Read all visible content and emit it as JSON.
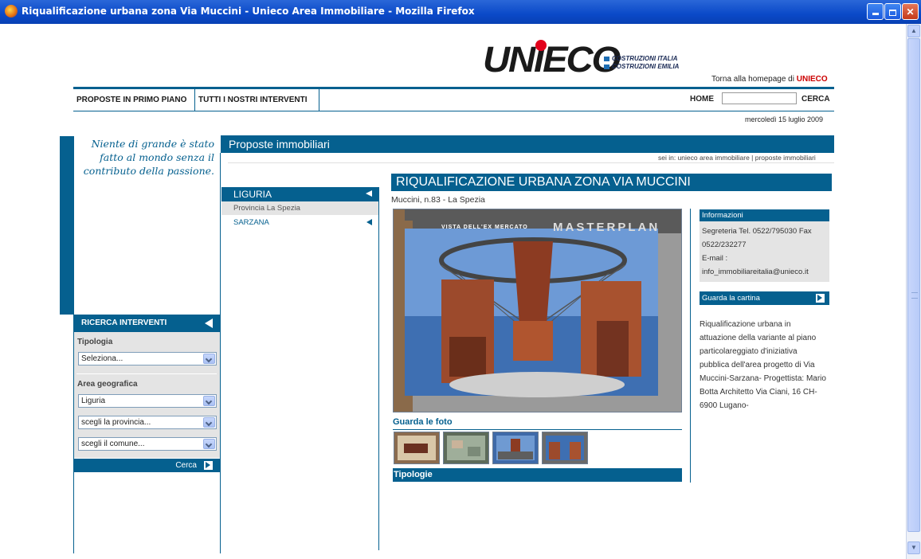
{
  "window": {
    "title": "Riqualificazione urbana zona Via Muccini - Unieco Area Immobiliare - Mozilla Firefox"
  },
  "header": {
    "logo_text": "UNIECO",
    "logo_sub1": "COSTRUZIONI ITALIA",
    "logo_sub2": "COSTRUZIONI EMILIA",
    "torna_prefix": "Torna alla homepage di",
    "torna_brand": "UNIECO",
    "nav": [
      "PROPOSTE IN PRIMO PIANO",
      "TUTTI I NOSTRI INTERVENTI"
    ],
    "home_label": "HOME",
    "search_value": "",
    "search_button": "CERCA",
    "date": "mercoledì 15 luglio 2009"
  },
  "sidebar": {
    "quote": "Niente di grande è stato fatto al mondo senza il contributo della passione.",
    "ricerca_title": "RICERCA INTERVENTI",
    "tipologia_label": "Tipologia",
    "tipologia_value": "Seleziona...",
    "area_label": "Area geografica",
    "area_value": "Liguria",
    "provincia_value": "scegli la provincia...",
    "comune_value": "scegli il comune...",
    "cerca_label": "Cerca"
  },
  "section": {
    "title": "Proposte immobiliari",
    "breadcrumb": "sei in: unieco area immobiliare | proposte immobiliari"
  },
  "region_menu": {
    "region": "LIGURIA",
    "province": "Provincia La Spezia",
    "town": "SARZANA"
  },
  "detail": {
    "title": "RIQUALIFICAZIONE URBANA ZONA VIA MUCCINI",
    "address": "Muccini, n.83 - La Spezia",
    "photo_caption_left": "VISTA DELL'EX MERCATO",
    "photo_caption_right": "MASTERPLAN",
    "gallery_label": "Guarda le foto",
    "tipologie_label": "Tipologie"
  },
  "info": {
    "title": "Informazioni",
    "line1": "Segreteria Tel. 0522/795030 Fax 0522/232277",
    "line2": "E-mail :",
    "line3": "info_immobiliareitalia@unieco.it",
    "map_label": "Guarda la cartina",
    "description": "Riqualificazione urbana in attuazione della variante al piano particolareggiato d'iniziativa pubblica dell'area progetto di Via Muccini-Sarzana- Progettista: Mario Botta Architetto Via Ciani, 16 CH-6900 Lugano-"
  }
}
